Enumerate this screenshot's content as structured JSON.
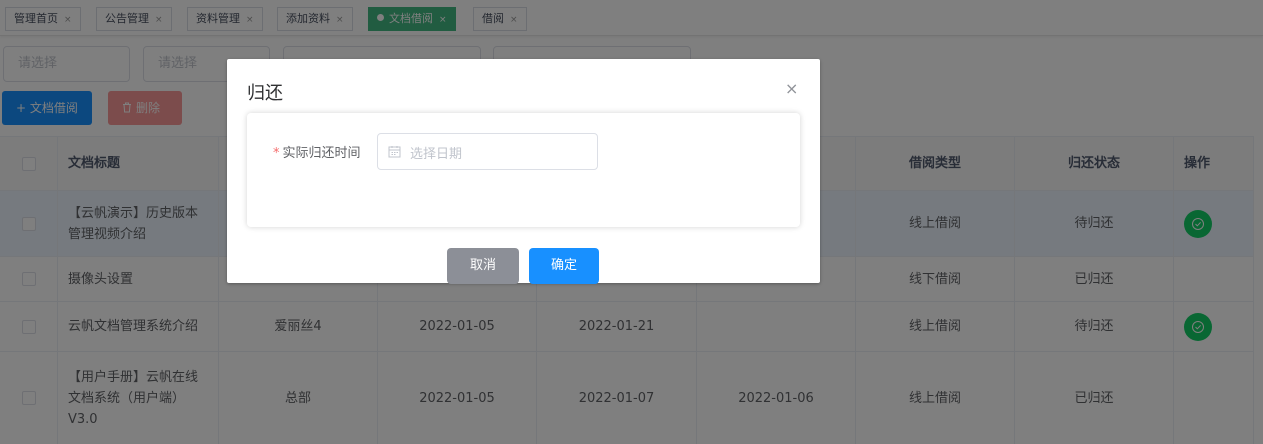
{
  "tags": [
    {
      "label": "管理首页",
      "active": false
    },
    {
      "label": "公告管理",
      "active": false
    },
    {
      "label": "资料管理",
      "active": false
    },
    {
      "label": "添加资料",
      "active": false
    },
    {
      "label": "文档借阅",
      "active": true
    },
    {
      "label": "借阅",
      "active": false
    }
  ],
  "tag_close_glyph": "×",
  "filters": {
    "filter1_placeholder": "请选择",
    "filter2_placeholder": "请选择"
  },
  "actions": {
    "add_label": "+ 文档借阅",
    "delete_label": "删除"
  },
  "table": {
    "headers": {
      "title": "文档标题",
      "borrow_type": "借阅类型",
      "return_status": "归还状态",
      "operation": "操作"
    },
    "rows": [
      {
        "title": "【云帆演示】历史版本管理视频介绍",
        "borrower": "",
        "borrow_date": "",
        "due_date": "",
        "actual_return": "",
        "borrow_type": "线上借阅",
        "return_status": "待归还",
        "has_action": true
      },
      {
        "title": "摄像头设置",
        "borrower": "",
        "borrow_date": "",
        "due_date": "",
        "actual_return": "",
        "borrow_type": "线下借阅",
        "return_status": "已归还",
        "has_action": false
      },
      {
        "title": "云帆文档管理系统介绍",
        "borrower": "爱丽丝4",
        "borrow_date": "2022-01-05",
        "due_date": "2022-01-21",
        "actual_return": "",
        "borrow_type": "线上借阅",
        "return_status": "待归还",
        "has_action": true
      },
      {
        "title": "【用户手册】云帆在线文档系统（用户端）V3.0",
        "borrower": "总部",
        "borrow_date": "2022-01-05",
        "due_date": "2022-01-07",
        "actual_return": "2022-01-06",
        "borrow_type": "线上借阅",
        "return_status": "已归还",
        "has_action": false
      }
    ]
  },
  "dialog": {
    "title": "归还",
    "close_glyph": "×",
    "required_mark": "*",
    "field_label": "实际归还时间",
    "date_placeholder": "选择日期",
    "cancel_label": "取消",
    "confirm_label": "确定"
  },
  "colors": {
    "primary": "#1890ff",
    "active_tag": "#42b983",
    "success": "#13ce66",
    "danger_light": "#f89898",
    "overlay": "rgba(0,0,0,0.5)"
  }
}
